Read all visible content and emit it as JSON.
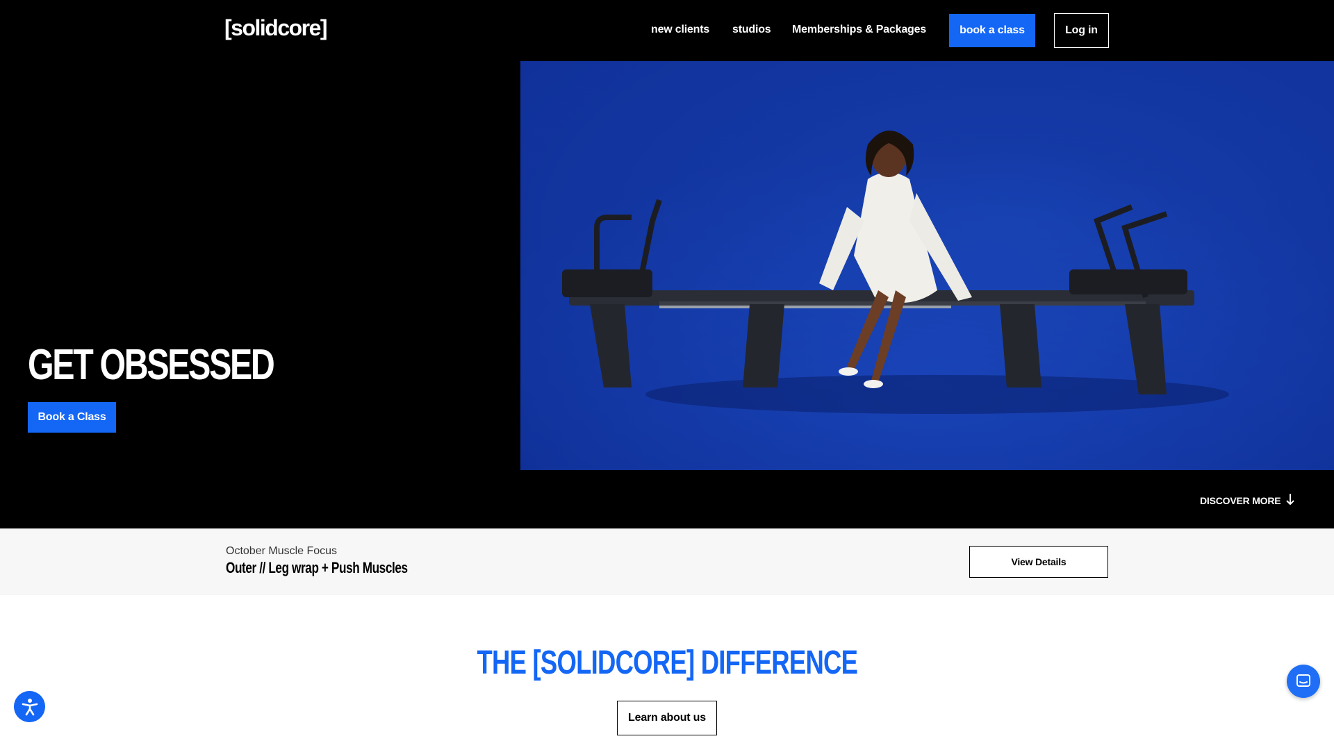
{
  "header": {
    "logo": "[solidcore]",
    "nav": {
      "new_clients": "new clients",
      "studios": "studios",
      "memberships": "Memberships & Packages",
      "book_class": "book a class",
      "login": "Log in"
    }
  },
  "hero": {
    "title": "GET OBSESSED",
    "cta": "Book a Class",
    "discover": "DISCOVER MORE",
    "photo_icon": "reformer-machine-photo"
  },
  "focus": {
    "label": "October Muscle Focus",
    "title": "Outer // Leg wrap + Push Muscles",
    "button": "View Details"
  },
  "difference": {
    "title": "THE [SOLIDCORE] DIFFERENCE",
    "button": "Learn about us"
  },
  "floating": {
    "accessibility_icon": "accessibility-icon",
    "chat_icon": "chat-icon"
  },
  "colors": {
    "brand_blue": "#1466f5",
    "photo_blue": "#173fb0",
    "black": "#000000"
  }
}
